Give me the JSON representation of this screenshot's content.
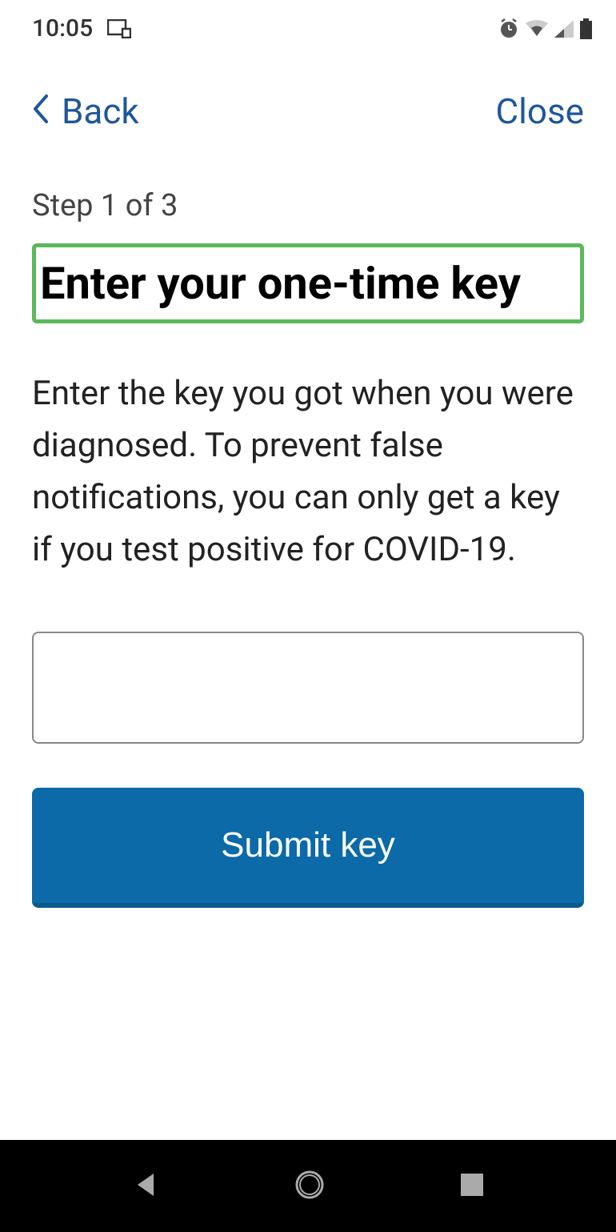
{
  "statusbar": {
    "time": "10:05"
  },
  "nav": {
    "back_label": "Back",
    "close_label": "Close"
  },
  "main": {
    "step": "Step 1 of 3",
    "heading": "Enter your one-time key",
    "body": "Enter the key you got when you were diagnosed. To prevent false notifications, you can only get a key if you test positive for COVID-19.",
    "key_value": "",
    "submit_label": "Submit key"
  }
}
